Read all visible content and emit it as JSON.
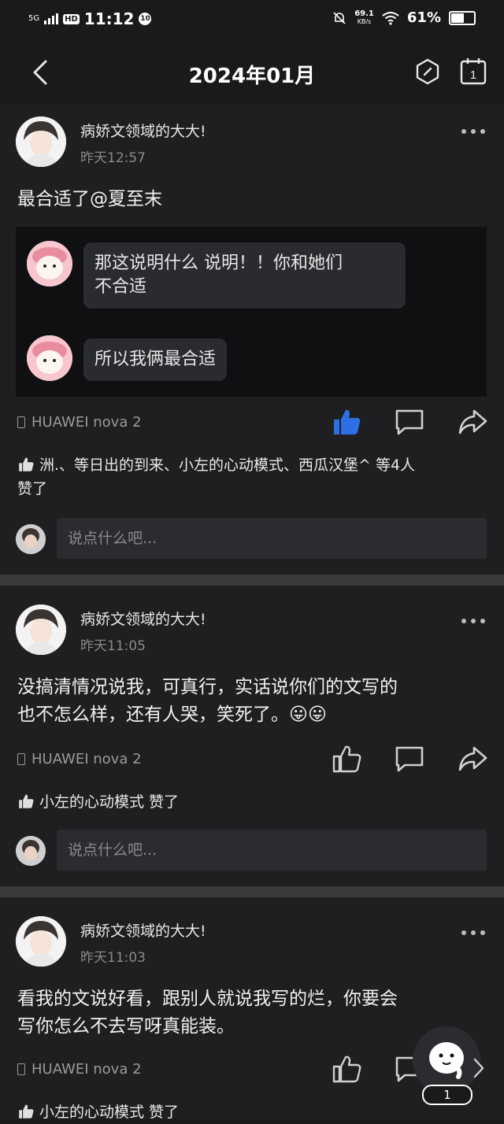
{
  "status_bar": {
    "network": "5G",
    "hd": "HD",
    "time": "11:12",
    "notif_badge": "10",
    "net_speed": "69.1",
    "net_unit": "KB/s",
    "battery": "61%",
    "battery_level": 0.61
  },
  "nav": {
    "title": "2024年01月",
    "back_icon": "back-arrow-icon",
    "hexagon_icon": "hexagon-icon",
    "calendar_icon": "calendar-icon",
    "calendar_day": "1"
  },
  "posts": [
    {
      "user": "病娇文领域的大大!",
      "time": "昨天12:57",
      "text": "最合适了@夏至末",
      "quote": [
        {
          "text_line1": "那这说明什么 说明！！你和她们",
          "text_line2": "不合适"
        },
        {
          "text_line1": "所以我俩最合适"
        }
      ],
      "device": "HUAWEI nova 2",
      "liked": true,
      "likes_line1": "洲.、等日出的到来、小左的心动模式、西瓜汉堡^ 等4人",
      "likes_line2": "赞了",
      "comment_placeholder": "说点什么吧..."
    },
    {
      "user": "病娇文领域的大大!",
      "time": "昨天11:05",
      "text_line1": "没搞清情况说我，可真行，实话说你们的文写的",
      "text_line2": "也不怎么样，还有人哭，笑死了。😛😛",
      "device": "HUAWEI nova 2",
      "liked": false,
      "likes": "小左的心动模式 赞了",
      "comment_placeholder": "说点什么吧..."
    },
    {
      "user": "病娇文领域的大大!",
      "time": "昨天11:03",
      "text_line1": "看我的文说好看，跟别人就说我写的烂，你要会",
      "text_line2": "写你怎么不去写呀真能装。",
      "device": "HUAWEI nova 2",
      "liked": false,
      "likes": "小左的心动模式 赞了"
    }
  ],
  "fab": {
    "badge": "1"
  },
  "colors": {
    "accent": "#2f6fe6",
    "background": "#1a1a1c",
    "card": "#1f1f22"
  }
}
